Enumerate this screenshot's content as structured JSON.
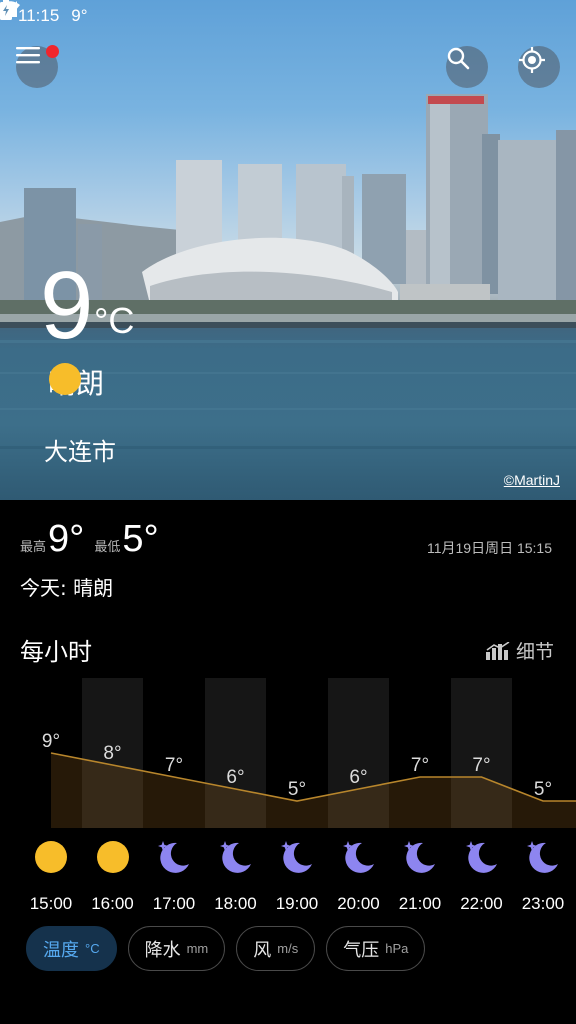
{
  "status_bar": {
    "time": "11:15",
    "temp": "9°"
  },
  "hero": {
    "temperature": "9",
    "unit": "°C",
    "condition": "晴朗",
    "city": "大连市",
    "photo_credit": "©MartinJ"
  },
  "summary": {
    "high_label": "最高",
    "high_value": "9°",
    "low_label": "最低",
    "low_value": "5°",
    "datetime": "11月19日周日 15:15",
    "today_text": "今天: 晴朗"
  },
  "hourly": {
    "title": "每小时",
    "details_label": "细节",
    "items": [
      {
        "time": "15:00",
        "temp": "9°",
        "value": 9,
        "icon": "sun-icon"
      },
      {
        "time": "16:00",
        "temp": "8°",
        "value": 8,
        "icon": "sun-icon"
      },
      {
        "time": "17:00",
        "temp": "7°",
        "value": 7,
        "icon": "moon-star-icon"
      },
      {
        "time": "18:00",
        "temp": "6°",
        "value": 6,
        "icon": "moon-star-icon"
      },
      {
        "time": "19:00",
        "temp": "5°",
        "value": 5,
        "icon": "moon-star-icon"
      },
      {
        "time": "20:00",
        "temp": "6°",
        "value": 6,
        "icon": "moon-star-icon"
      },
      {
        "time": "21:00",
        "temp": "7°",
        "value": 7,
        "icon": "moon-star-icon"
      },
      {
        "time": "22:00",
        "temp": "7°",
        "value": 7,
        "icon": "moon-star-icon"
      },
      {
        "time": "23:00",
        "temp": "5°",
        "value": 5,
        "icon": "moon-star-icon"
      }
    ]
  },
  "chips": [
    {
      "label": "温度",
      "unit": "°C",
      "active": true
    },
    {
      "label": "降水",
      "unit": "mm",
      "active": false
    },
    {
      "label": "风",
      "unit": "m/s",
      "active": false
    },
    {
      "label": "气压",
      "unit": "hPa",
      "active": false
    }
  ],
  "colors": {
    "accent": "#56a9ef",
    "sun": "#f7bd2a",
    "moon": "#8d85f0",
    "chart_line": "#b8862c"
  }
}
